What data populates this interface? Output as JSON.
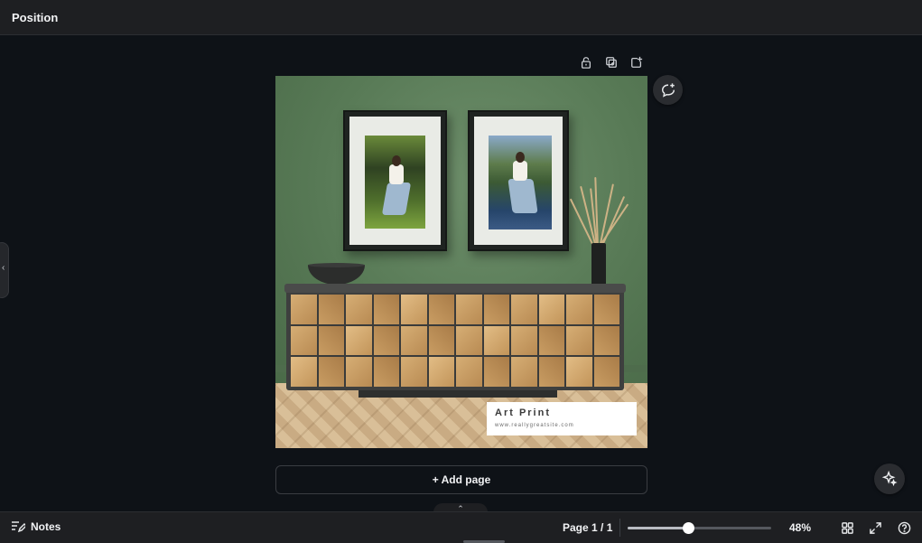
{
  "header": {
    "title": "Position"
  },
  "page_tools": {
    "items": [
      {
        "name": "lock-icon"
      },
      {
        "name": "duplicate-page-icon"
      },
      {
        "name": "add-page-icon"
      }
    ]
  },
  "design": {
    "label_title": "Art Print",
    "label_url": "www.reallygreatsite.com",
    "colors": {
      "wall": "#587a56",
      "label_bg": "#ffffff"
    }
  },
  "canvas": {
    "add_page_label": "+ Add page"
  },
  "footer": {
    "notes_label": "Notes",
    "page_indicator": "Page 1 / 1",
    "zoom_label": "48%",
    "zoom_fraction": 0.42
  },
  "theme": {
    "accent": "#ffffff",
    "background": "#0e1217",
    "bar": "#1e1f22"
  }
}
